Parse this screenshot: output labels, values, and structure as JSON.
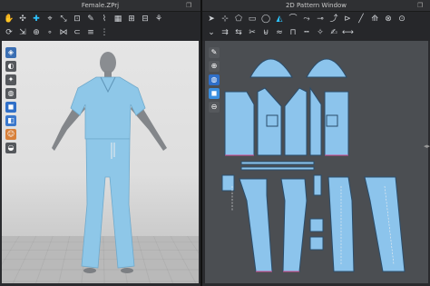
{
  "left_window": {
    "title": "Female.ZPrj"
  },
  "right_window": {
    "title": "2D Pattern Window"
  },
  "left_toolbar_icons": [
    "select-icon",
    "move-icon",
    "add-icon",
    "pin-icon",
    "fold-icon",
    "tack-icon",
    "brush-icon",
    "sewing-icon",
    "grid-icon",
    "ruler-icon",
    "measure-icon",
    "avatar-icon"
  ],
  "right_toolbar_icons": [
    "pointer-icon",
    "edit-icon",
    "polygon-icon",
    "rectangle-icon",
    "circle-icon",
    "dart-icon",
    "trace-icon",
    "sew-icon",
    "segment-icon",
    "free-sew-icon",
    "fold-icon",
    "line-icon",
    "grade-icon",
    "internal-icon",
    "button-icon",
    "topstitch-icon"
  ],
  "colors": {
    "pattern_fill": "#8cc4ec",
    "pattern_stroke": "#2a4c6a",
    "garment": "#8ec7e8",
    "accent": "#2ec4ff"
  }
}
